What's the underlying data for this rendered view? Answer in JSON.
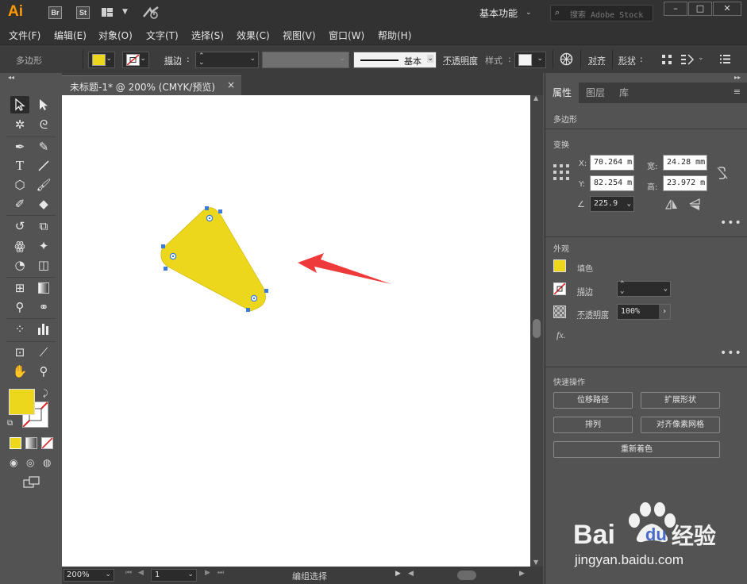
{
  "app": {
    "logo": "Ai",
    "bridge": "Br",
    "stock": "St",
    "workspace": "基本功能",
    "search_placeholder": "搜索 Adobe Stock",
    "min": "–",
    "max": "□",
    "close": "✕"
  },
  "menu": [
    "文件(F)",
    "编辑(E)",
    "对象(O)",
    "文字(T)",
    "选择(S)",
    "效果(C)",
    "视图(V)",
    "窗口(W)",
    "帮助(H)"
  ],
  "control": {
    "object_type": "多边形",
    "stroke_label": "描边",
    "stroke_style": "基本",
    "opacity_label": "不透明度",
    "style_label": "样式",
    "align_label": "对齐",
    "shape_label": "形状"
  },
  "document": {
    "tab_title": "未标题-1* @ 200% (CMYK/预览)",
    "tab_close": "×",
    "zoom": "200%",
    "page": "1",
    "status": "编组选择"
  },
  "panel": {
    "tabs": [
      "属性",
      "图层",
      "库"
    ],
    "object_type": "多边形",
    "transform_title": "变换",
    "x_label": "X:",
    "x": "70.264 m",
    "y_label": "Y:",
    "y": "82.254 m",
    "w_label": "宽:",
    "w": "24.28 mm",
    "h_label": "高:",
    "h": "23.972 m",
    "angle": "225.9",
    "appearance_title": "外观",
    "fill_label": "填色",
    "stroke_label": "描边",
    "opacity_label": "不透明度",
    "opacity_value": "100%",
    "fx_label": "fx.",
    "quick_title": "快速操作",
    "btn_offset": "位移路径",
    "btn_expand": "扩展形状",
    "btn_arrange": "排列",
    "btn_pixel": "对齐像素网格",
    "btn_recolor": "重新着色"
  },
  "watermark": {
    "brand_a": "Bai",
    "brand_b": "du",
    "brand_c": "经验",
    "url": "jingyan.baidu.com"
  },
  "colors": {
    "fill": "#ecd71d",
    "arrow": "#ee3a3a",
    "selection": "#3b7be0"
  }
}
